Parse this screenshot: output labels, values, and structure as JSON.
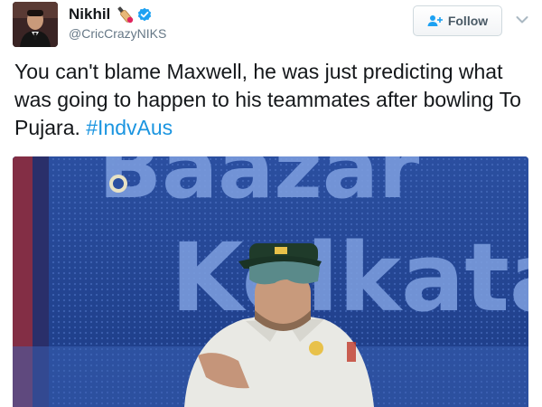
{
  "tweet": {
    "author": {
      "display_name": "Nikhil",
      "handle": "@CricCrazyNIKS",
      "avatar_icon": "profile-photo",
      "badge_icons": [
        "cricket-bat-emoji",
        "verified-badge-icon"
      ]
    },
    "follow_button": {
      "label": "Follow",
      "icon": "add-user-icon"
    },
    "menu_icon": "chevron-down-icon",
    "text": {
      "body": "You can't blame Maxwell, he was just predicting what was going to happen to his teammates after bowling To Pujara. ",
      "hashtag": "#IndvAus"
    },
    "media": {
      "type": "photo",
      "description_icon": "cricketer-photo",
      "board_text_top": "Baazar",
      "board_text_bottom": "Kolkata"
    }
  },
  "colors": {
    "text_primary": "#14171a",
    "text_secondary": "#657786",
    "link": "#1b95e0",
    "verified": "#1da1f2"
  }
}
